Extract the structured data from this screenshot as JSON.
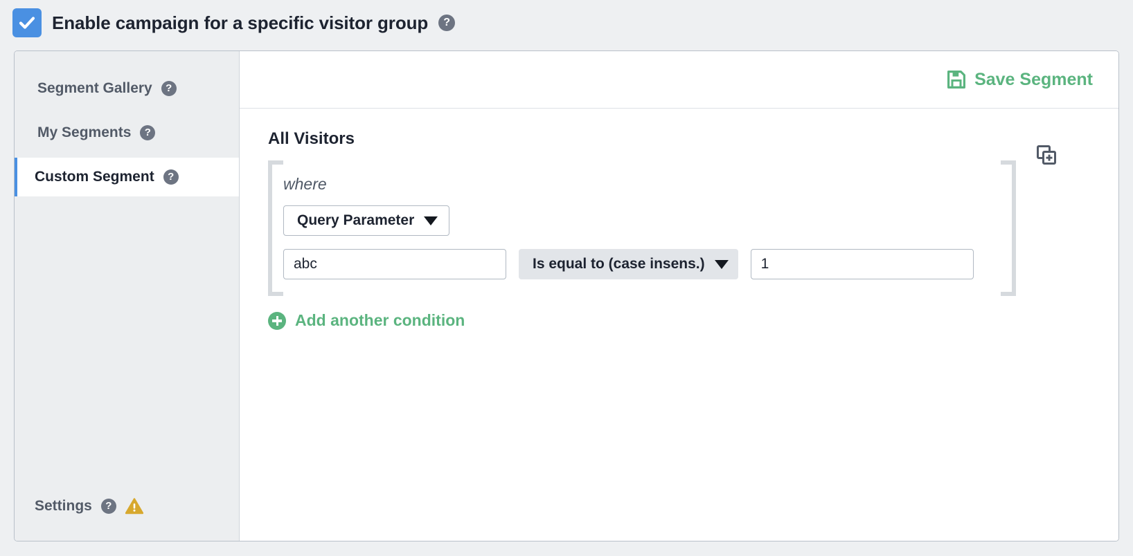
{
  "enable": {
    "label": "Enable campaign for a specific visitor group",
    "checked": true,
    "checkbox_color": "#4a90e2",
    "help_icon": "question-mark-icon"
  },
  "sidebar": {
    "items": [
      {
        "label": "Segment Gallery",
        "active": false,
        "help_icon": "question-mark-icon"
      },
      {
        "label": "My Segments",
        "active": false,
        "help_icon": "question-mark-icon"
      },
      {
        "label": "Custom Segment",
        "active": true,
        "help_icon": "question-mark-icon"
      }
    ],
    "settings": {
      "label": "Settings",
      "help_icon": "question-mark-icon",
      "warning_icon": "warning-triangle-icon",
      "warning_color": "#d7a82e"
    },
    "active_indicator_color": "#4a90e2",
    "background": "#eceef0"
  },
  "header": {
    "save_label": "Save Segment",
    "save_icon": "floppy-disk-icon",
    "accent_color": "#5bb47f"
  },
  "segment": {
    "title": "All Visitors",
    "where_label": "where",
    "duplicate_icon": "duplicate-condition-icon",
    "condition": {
      "dimension": "Query Parameter",
      "keyword_value": "abc",
      "keyword_placeholder": "",
      "operator": "Is equal to (case insens.)",
      "value": "1",
      "value_placeholder": ""
    },
    "add_condition_label": "Add another condition",
    "add_condition_icon": "plus-circle-icon"
  }
}
